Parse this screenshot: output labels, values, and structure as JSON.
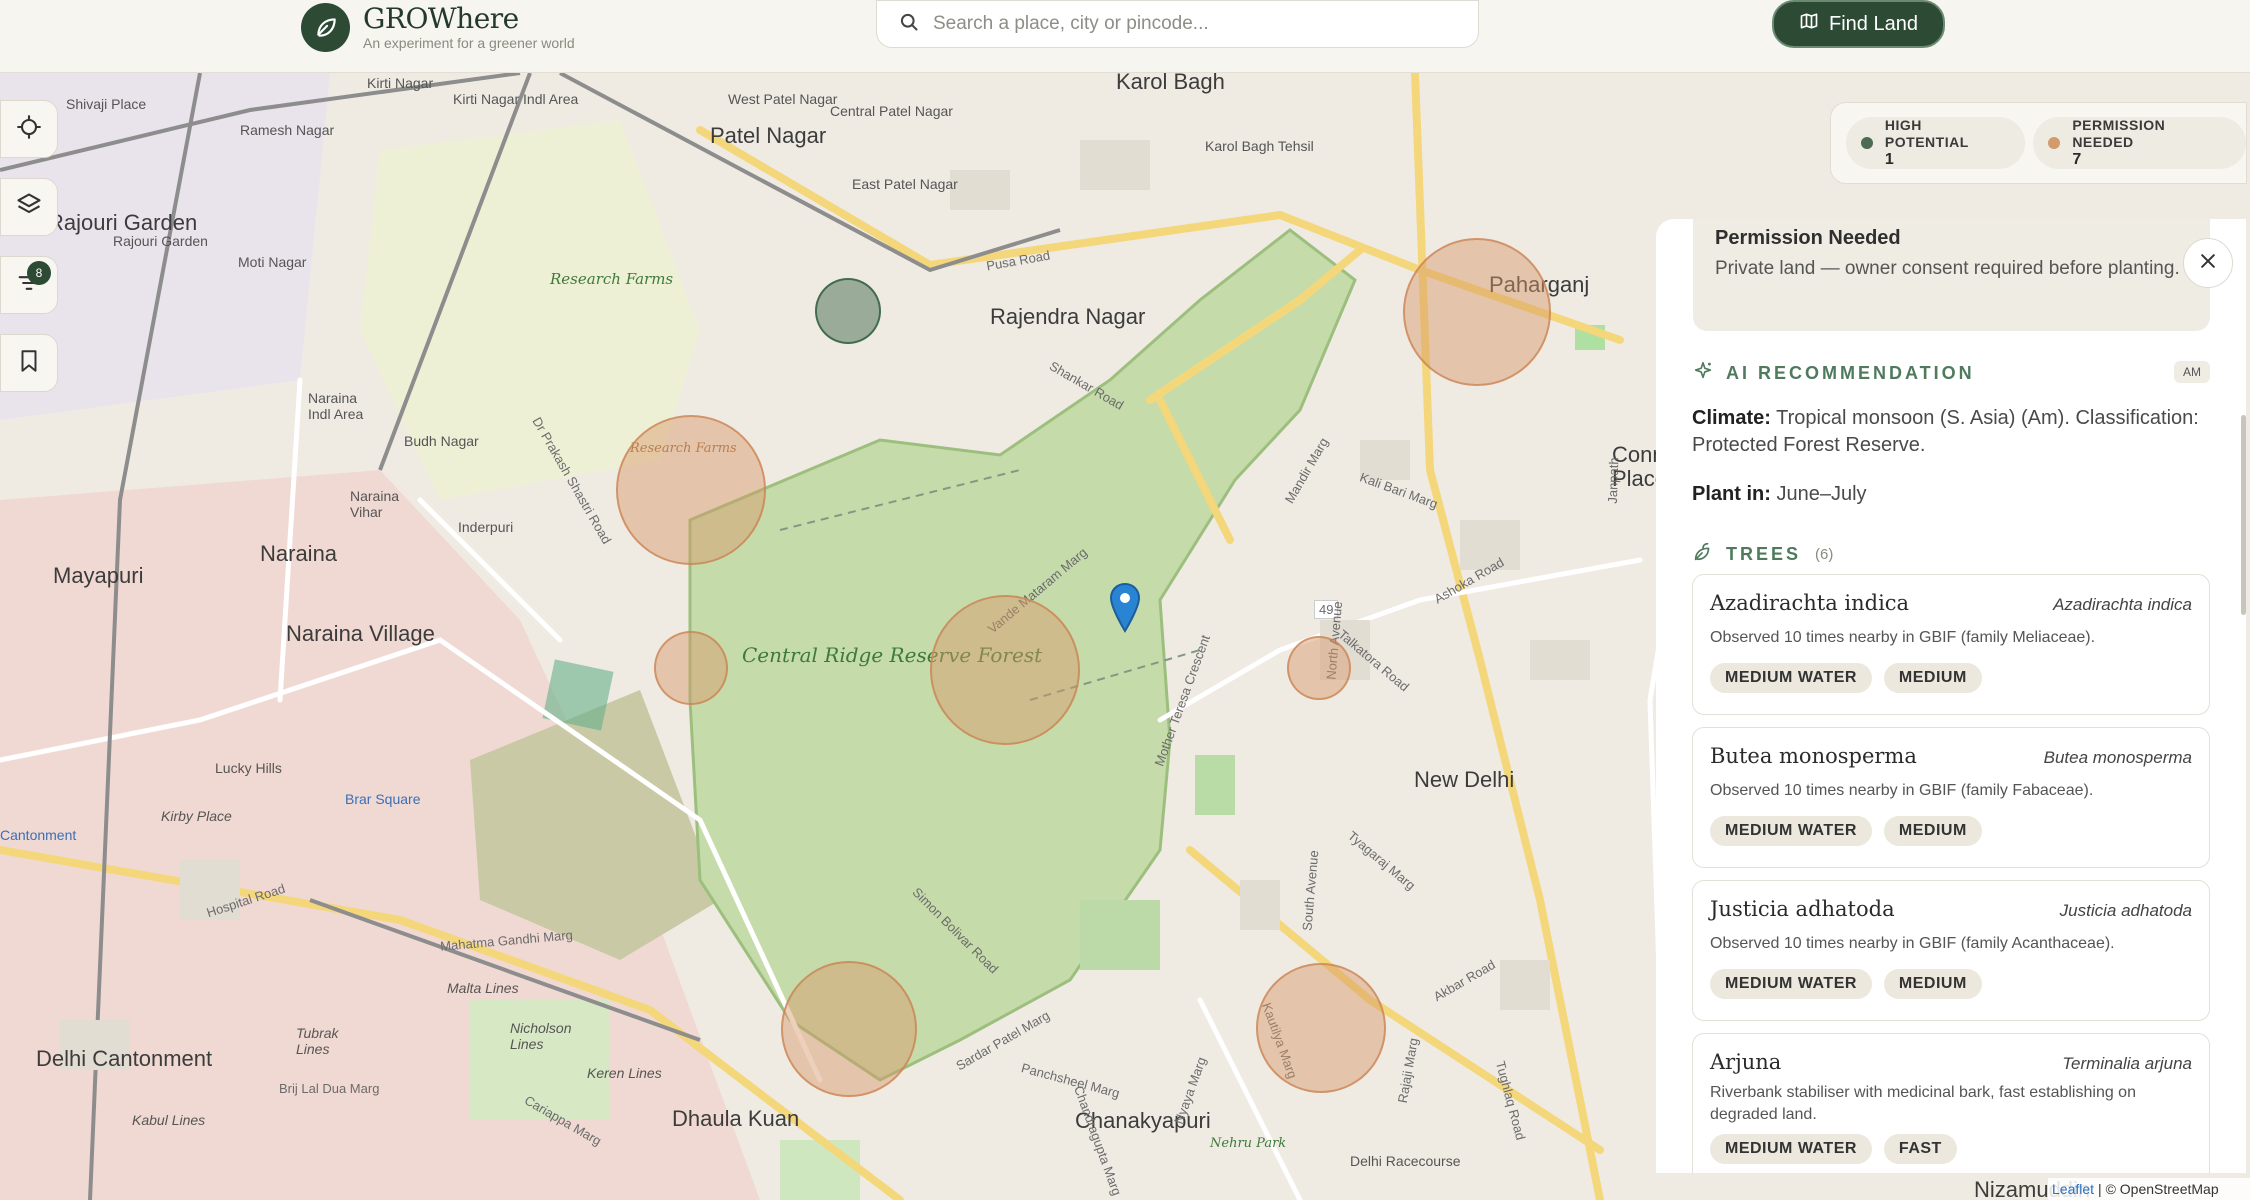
{
  "header": {
    "brand_name": "GROWhere",
    "brand_tagline": "An experiment for a greener world",
    "search_placeholder": "Search a place, city or pincode...",
    "find_button": "Find Land"
  },
  "map": {
    "labels": {
      "shivaji_place": "Shivaji Place",
      "kirti_nagar": "Kirti Nagar",
      "kirti_nagar_indl": "Kirti Nagar Indl Area",
      "west_patel": "West Patel Nagar",
      "central_patel": "Central Patel Nagar",
      "karol_bagh": "Karol Bagh",
      "karol_bagh_tehsil": "Karol Bagh Tehsil",
      "ramesh_nagar": "Ramesh Nagar",
      "patel_nagar": "Patel Nagar",
      "east_patel": "East Patel Nagar",
      "rajouri_garden": "Rajouri Garden",
      "rajouri_garden_small": "Rajouri Garden",
      "moti_nagar": "Moti Nagar",
      "research_farms": "Research Farms",
      "research_farms_2": "Research Farms",
      "rajendra_nagar": "Rajendra Nagar",
      "paharganj": "Paharganj",
      "naraina_indl": "Naraina Indl Area",
      "buddh_nagar": "Budh Nagar",
      "naraina_vihar": "Naraina Vihar",
      "inderpuri": "Inderpuri",
      "naraina": "Naraina",
      "mayapuri": "Mayapuri",
      "naraina_village": "Naraina Village",
      "central_ridge": "Central Ridge Reserve Forest",
      "connaught": "Connaught Place",
      "new_delhi": "New Delhi",
      "lucky_hills": "Lucky Hills",
      "kirby_place": "Kirby Place",
      "brar_square": "Brar Square",
      "cantonment": "Cantonment",
      "hospital_road": "Hospital Road",
      "malta_lines": "Malta Lines",
      "tubrak_lines": "Tubrak Lines",
      "nicholson_lines": "Nicholson Lines",
      "keren_lines": "Keren Lines",
      "delhi_cantonment": "Delhi Cantonment",
      "brij_lal_dua": "Brij Lal Dua Marg",
      "kabul_lines": "Kabul Lines",
      "dhaula_kuan": "Dhaula Kuan",
      "chanakyapuri": "Chanakyapuri",
      "nehru_park": "Nehru Park",
      "nizamuddin": "Nizamuddin",
      "delhi_racecourse": "Delhi Racecourse",
      "road_49": "49",
      "pusa_road": "Pusa Road",
      "shankar_road": "Shankar Road",
      "vande_mataram": "Vande Mataram Marg",
      "mother_teresa": "Mother Teresa Crescent",
      "sardar_patel": "Sardar Patel Marg",
      "simon_bolivar": "Simon Bolivar Road",
      "mahatma_gandhi": "Mahatma Gandhi Marg",
      "cariappa": "Cariappa Marg",
      "ashoka_road": "Ashoka Road",
      "akbar_road": "Akbar Road",
      "tyagaraj": "Tyagaraj Marg",
      "south_avenue": "South Avenue",
      "north_avenue": "North Avenue",
      "talkatora": "Talkatora Road",
      "kali_bari": "Kali Bari Marg",
      "mandir_marg": "Mandir Marg",
      "dpsr": "Dr Prakash Shastri Road",
      "nyaya_marg": "Nyaya Marg",
      "panchsheel": "Panchsheel Marg",
      "chandragupta": "Chandragupta Marg",
      "rajaji_marg": "Rajaji Marg",
      "tughlaq_road": "Tughlaq Road",
      "kautilya": "Kautilya Marg",
      "janpath": "Janpath"
    },
    "tools": {
      "filter_badge": "8"
    },
    "legend": {
      "high_label": "HIGH POTENTIAL",
      "high_count": "1",
      "high_color": "#4d6b52",
      "perm_label": "PERMISSION NEEDED",
      "perm_count": "7",
      "perm_color": "#d39a6a"
    },
    "attribution": {
      "leaflet": "Leaflet",
      "osm": "| © OpenStreetMap"
    }
  },
  "panel": {
    "status_title": "Permission Needed",
    "status_text": "Private land — owner consent required before planting.",
    "ai_title": "AI RECOMMENDATION",
    "climate_tag": "AM",
    "climate_label": "Climate:",
    "climate_value": "Tropical monsoon (S. Asia) (Am). Classification: Protected Forest Reserve.",
    "plant_label": "Plant in:",
    "plant_value": "June–July",
    "trees_title": "TREES",
    "trees_count": "(6)",
    "trees": [
      {
        "name": "Azadirachta indica",
        "scientific": "Azadirachta indica",
        "description": "Observed 10 times nearby in GBIF (family Meliaceae).",
        "water": "MEDIUM WATER",
        "growth": "MEDIUM"
      },
      {
        "name": "Butea monosperma",
        "scientific": "Butea monosperma",
        "description": "Observed 10 times nearby in GBIF (family Fabaceae).",
        "water": "MEDIUM WATER",
        "growth": "MEDIUM"
      },
      {
        "name": "Justicia adhatoda",
        "scientific": "Justicia adhatoda",
        "description": "Observed 10 times nearby in GBIF (family Acanthaceae).",
        "water": "MEDIUM WATER",
        "growth": "MEDIUM"
      },
      {
        "name": "Arjuna",
        "scientific": "Terminalia arjuna",
        "description": "Riverbank stabiliser with medicinal bark, fast establishing on degraded land.",
        "water": "MEDIUM WATER",
        "growth": "FAST"
      }
    ]
  }
}
